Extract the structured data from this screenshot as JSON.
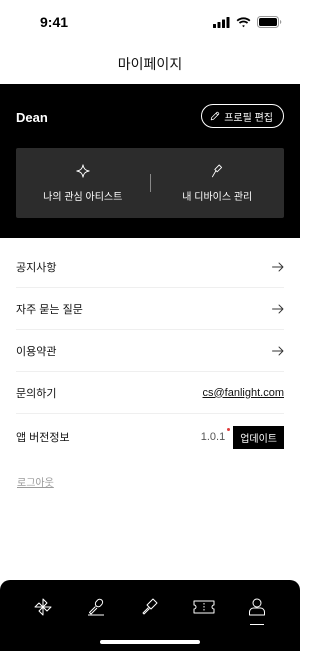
{
  "status_bar": {
    "time": "9:41"
  },
  "header": {
    "title": "마이페이지"
  },
  "profile": {
    "name": "Dean",
    "edit_label": "프로필 편집"
  },
  "quick_actions": [
    {
      "label": "나의 관심 아티스트",
      "icon": "sparkle-icon"
    },
    {
      "label": "내 디바이스 관리",
      "icon": "lightstick-icon"
    }
  ],
  "menu": {
    "notice": "공지사항",
    "faq": "자주 묻는 질문",
    "terms": "이용약관",
    "contact_label": "문의하기",
    "contact_email": "cs@fanlight.com",
    "version_label": "앱 버전정보",
    "version_value": "1.0.1",
    "update_label": "업데이트"
  },
  "logout": "로그아웃",
  "bottom_nav": [
    {
      "icon": "pinwheel-icon",
      "active": false
    },
    {
      "icon": "microphone-icon",
      "active": false
    },
    {
      "icon": "lightstick-icon",
      "active": false
    },
    {
      "icon": "ticket-icon",
      "active": false
    },
    {
      "icon": "person-icon",
      "active": true
    }
  ],
  "colors": {
    "dark": "#000000",
    "panel": "#2c2c2c",
    "update_dot": "#e03a3a"
  }
}
